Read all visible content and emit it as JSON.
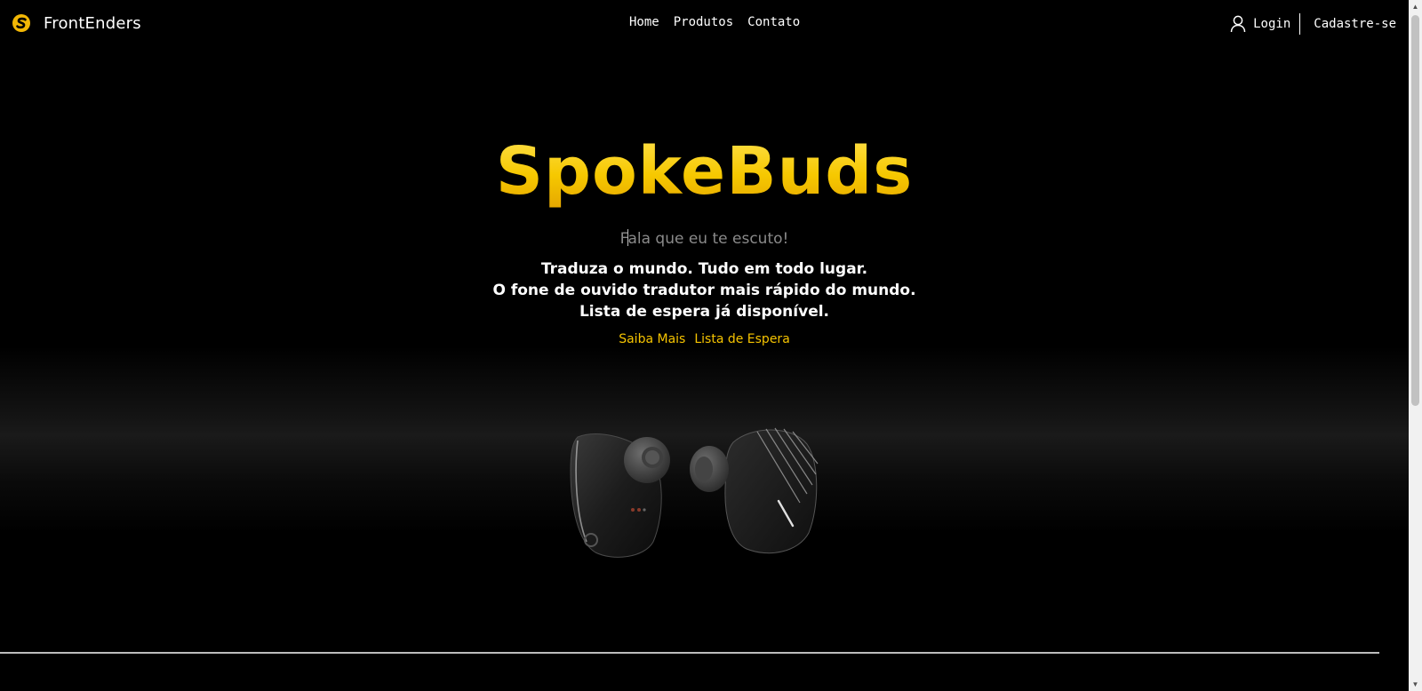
{
  "header": {
    "brand_name": "FrontEnders",
    "brand_icon": "s-coin-logo",
    "nav": [
      "Home",
      "Produtos",
      "Contato"
    ],
    "login_label": "Login",
    "signup_label": "Cadastre-se"
  },
  "hero": {
    "title": "SpokeBuds",
    "tagline_first": "F",
    "tagline_rest": "ala que eu te escuto!",
    "description": [
      "Traduza o mundo. Tudo em todo lugar.",
      "O fone de ouvido tradutor mais rápido do mundo.",
      "Lista de espera já disponível."
    ],
    "cta": [
      "Saiba Mais",
      "Lista de Espera"
    ]
  },
  "colors": {
    "accent": "#f6c400",
    "background": "#000000",
    "tagline": "#8a8a8a"
  }
}
